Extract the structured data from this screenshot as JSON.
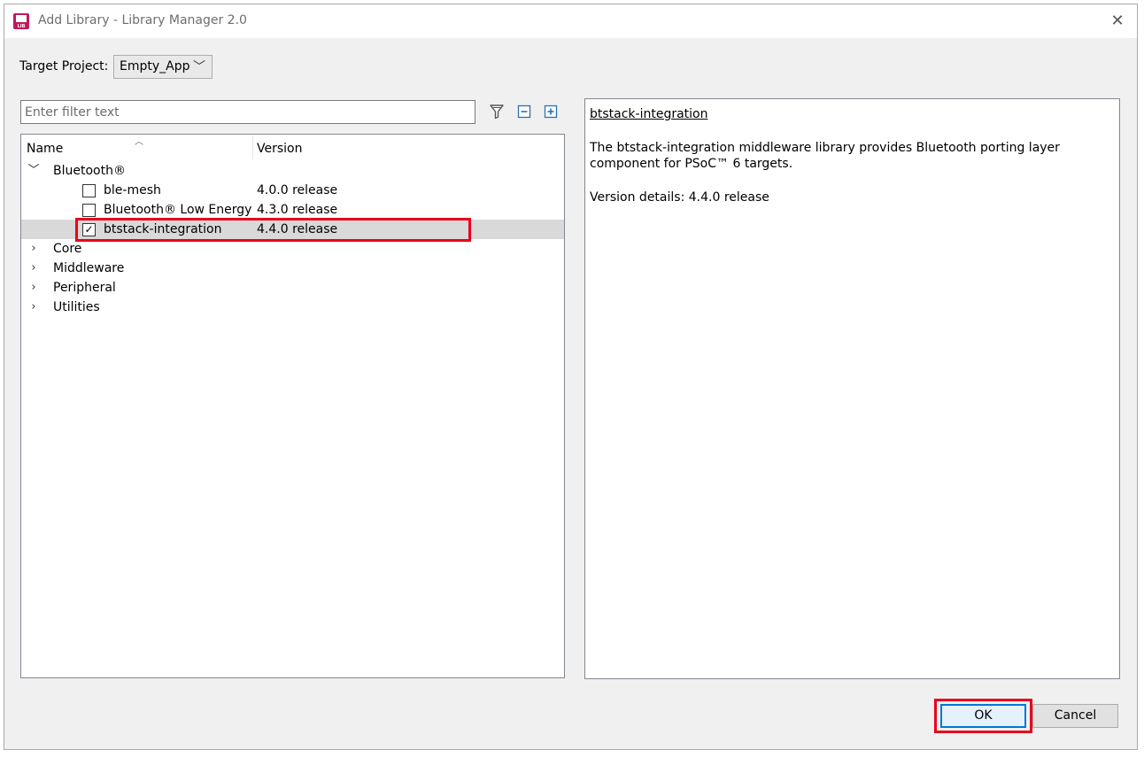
{
  "window": {
    "title": "Add Library - Library Manager 2.0",
    "icon_label": "LIB",
    "close_glyph": "✕"
  },
  "target_project": {
    "label": "Target Project:",
    "value": "Empty_App"
  },
  "filter": {
    "placeholder": "Enter filter text"
  },
  "tree": {
    "columns": {
      "name": "Name",
      "version": "Version"
    },
    "categories": [
      {
        "label": "Bluetooth®",
        "expanded": true,
        "items": [
          {
            "name": "ble-mesh",
            "version": "4.0.0 release",
            "checked": false
          },
          {
            "name": "Bluetooth® Low Energy",
            "version": "4.3.0 release",
            "checked": false
          },
          {
            "name": "btstack-integration",
            "version": "4.4.0 release",
            "checked": true
          }
        ]
      },
      {
        "label": "Core",
        "expanded": false
      },
      {
        "label": "Middleware",
        "expanded": false
      },
      {
        "label": "Peripheral",
        "expanded": false
      },
      {
        "label": "Utilities",
        "expanded": false
      }
    ]
  },
  "details": {
    "title": "btstack-integration",
    "description": "The btstack-integration middleware library provides Bluetooth porting layer component for PSoC™ 6 targets.",
    "version_details": "Version details: 4.4.0 release"
  },
  "buttons": {
    "ok": "OK",
    "cancel": "Cancel"
  },
  "colors": {
    "highlight": "#e8001c",
    "ok_border": "#0078d7",
    "selected_row": "#d9d9d9"
  }
}
